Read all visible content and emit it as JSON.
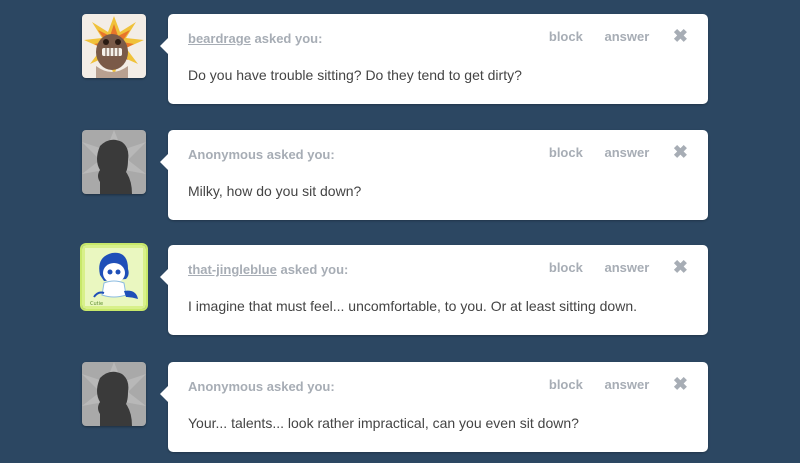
{
  "actions": {
    "block_label": "block",
    "answer_label": "answer",
    "close_glyph": "✖"
  },
  "asked_suffix": "asked you:",
  "posts": [
    {
      "asker": "beardrage",
      "is_link": true,
      "avatar_icon": "explosion-face-avatar",
      "question": "Do you have trouble sitting? Do they tend to get dirty?"
    },
    {
      "asker": "Anonymous",
      "is_link": false,
      "avatar_icon": "anonymous-silhouette-avatar",
      "question": "Milky, how do you sit down?"
    },
    {
      "asker": "that-jingleblue",
      "is_link": true,
      "avatar_icon": "cartoon-character-avatar",
      "question": "I imagine that must feel... uncomfortable, to you. Or at least sitting down."
    },
    {
      "asker": "Anonymous",
      "is_link": false,
      "avatar_icon": "anonymous-silhouette-avatar",
      "question": "Your... talents... look rather impractical, can you even sit down?"
    }
  ],
  "colors": {
    "background": "#2c4762",
    "card": "#ffffff",
    "muted_text": "#a7adb5",
    "body_text": "#444444"
  }
}
